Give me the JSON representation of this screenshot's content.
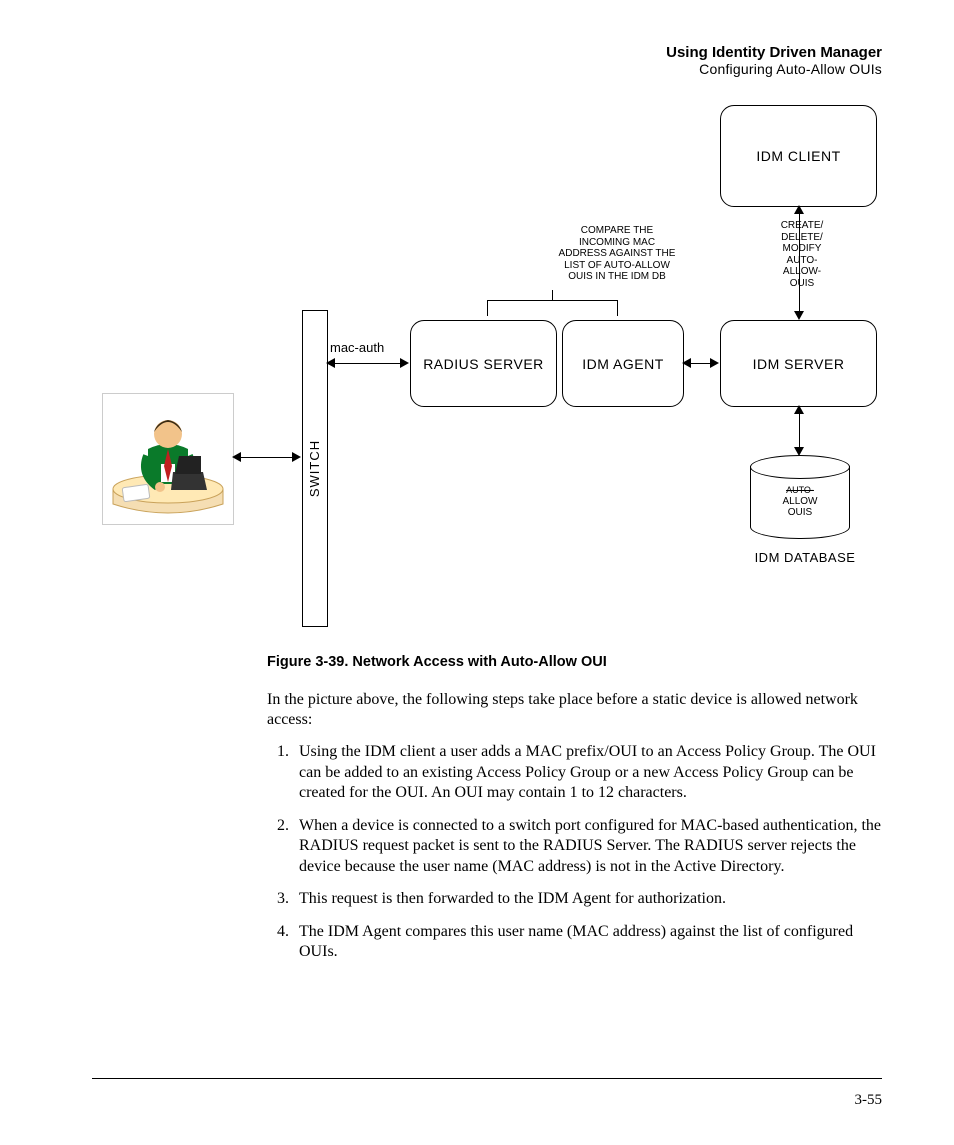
{
  "header": {
    "title": "Using Identity Driven Manager",
    "subtitle": "Configuring Auto-Allow OUIs"
  },
  "diagram": {
    "nodes": {
      "idm_client": "IDM CLIENT",
      "radius_server": "RADIUS SERVER",
      "idm_agent": "IDM AGENT",
      "idm_server": "IDM SERVER",
      "switch": "SWITCH",
      "idm_database": "IDM DATABASE"
    },
    "annotations": {
      "compare_text": "COMPARE THE\nINCOMING MAC\nADDRESS AGAINST THE\nLIST OF AUTO-ALLOW\nOUIS IN THE IDM DB",
      "create_text": "CREATE/\nDELETE/\nMODIFY\nAUTO-\nALLOW-\nOUIS",
      "mac_auth": "mac-auth",
      "db_text": "AUTO-\nALLOW\nOUIS"
    }
  },
  "caption": "Figure 3-39. Network Access with Auto-Allow OUI",
  "intro": "In the picture above, the following steps take place before a static device is allowed network access:",
  "steps": [
    "Using the IDM client a user adds a MAC prefix/OUI to an Access Policy Group. The OUI can be added to an existing Access Policy Group or a new Access Policy Group can be created for the OUI. An OUI may contain 1 to 12 characters.",
    "When a device is connected to a switch port configured for MAC-based authentication, the RADIUS request packet is sent to the RADIUS Server. The RADIUS server rejects the device because the user name (MAC address) is not in the Active Directory.",
    "This request is then forwarded to the IDM Agent for authorization.",
    "The IDM Agent compares this user name (MAC address) against the list of configured OUIs."
  ],
  "page_number": "3-55"
}
